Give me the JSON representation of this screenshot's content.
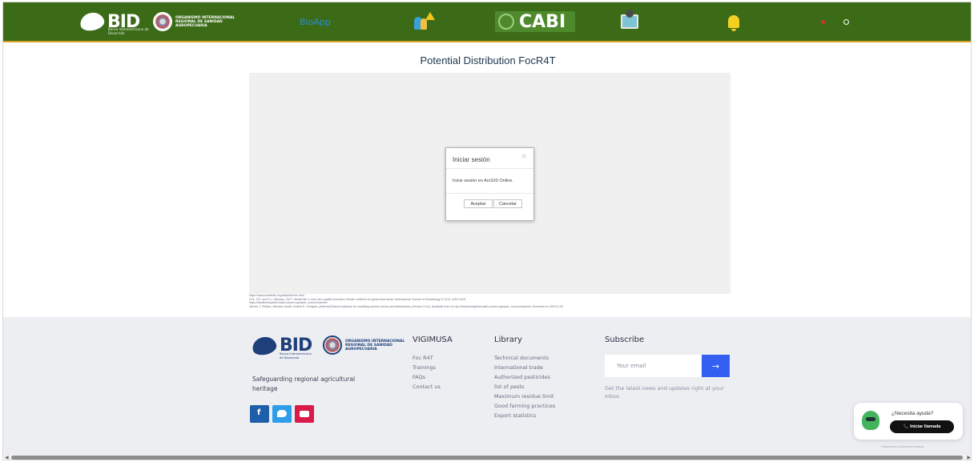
{
  "header": {
    "bid_logo_text": "BID",
    "bid_logo_sub": "Banco Interamericano de Desarrollo",
    "oirsa_logo_text": "ORGANISMO INTERNACIONAL REGIONAL DE SANIDAD AGROPECUARIA",
    "bioapp_label": "BioApp",
    "cabi_logo_text": "CABI",
    "colors": {
      "bar": "#3c6b18",
      "accent_line": "#d8a226"
    }
  },
  "page": {
    "title": "Potential Distribution FocR4T"
  },
  "dialog": {
    "title": "Iniciar sesión",
    "close": "×",
    "message": "Inicie sesión en ArcGIS Online.",
    "accept": "Aceptar",
    "cancel": "Cancelar"
  },
  "references": [
    "https://www.worldclim.org/data/bioclim.html",
    "Fick, S.E. and R.J. Hijmans, 2017. WorldClim 2: new 1km spatial resolution climate surfaces for global land areas. International Journal of Climatology 37 (12): 4302-4315.",
    "https://biodiversityinformatics.amnh.org/open_source/maxent/",
    "Steven J. Phillips, Miroslav Dudík, Robert E. Schapire. [Internet] Maxent software for modeling species niches and distributions (Version 3.4.1). Available from url: ttp://biodiversityinformatics.amnh.org/open_source/maxent/. Accessed on 2023-6-29."
  ],
  "footer": {
    "tagline": "Safeguarding regional agricultural heritage",
    "vigimusa": {
      "heading": "VIGIMUSA",
      "links": [
        "Foc R4T",
        "Trainings",
        "FAQs",
        "Contact us"
      ]
    },
    "library": {
      "heading": "Library",
      "links": [
        "Technical documents",
        "International trade",
        "Authorized pesticides",
        "list of pests",
        "Maximum residue limit",
        "Good farming practices",
        "Export statistics"
      ]
    },
    "subscribe": {
      "heading": "Subscribe",
      "placeholder": "Your email",
      "button_icon": "→",
      "note": "Get the latest news and updates right at your inbox."
    },
    "social": [
      "facebook-icon",
      "twitter-icon",
      "youtube-icon"
    ]
  },
  "help_widget": {
    "title": "¿Necesita ayuda?",
    "button": "📞 Iniciar llamada",
    "powered": "Powered by DecenLabs Brands"
  }
}
